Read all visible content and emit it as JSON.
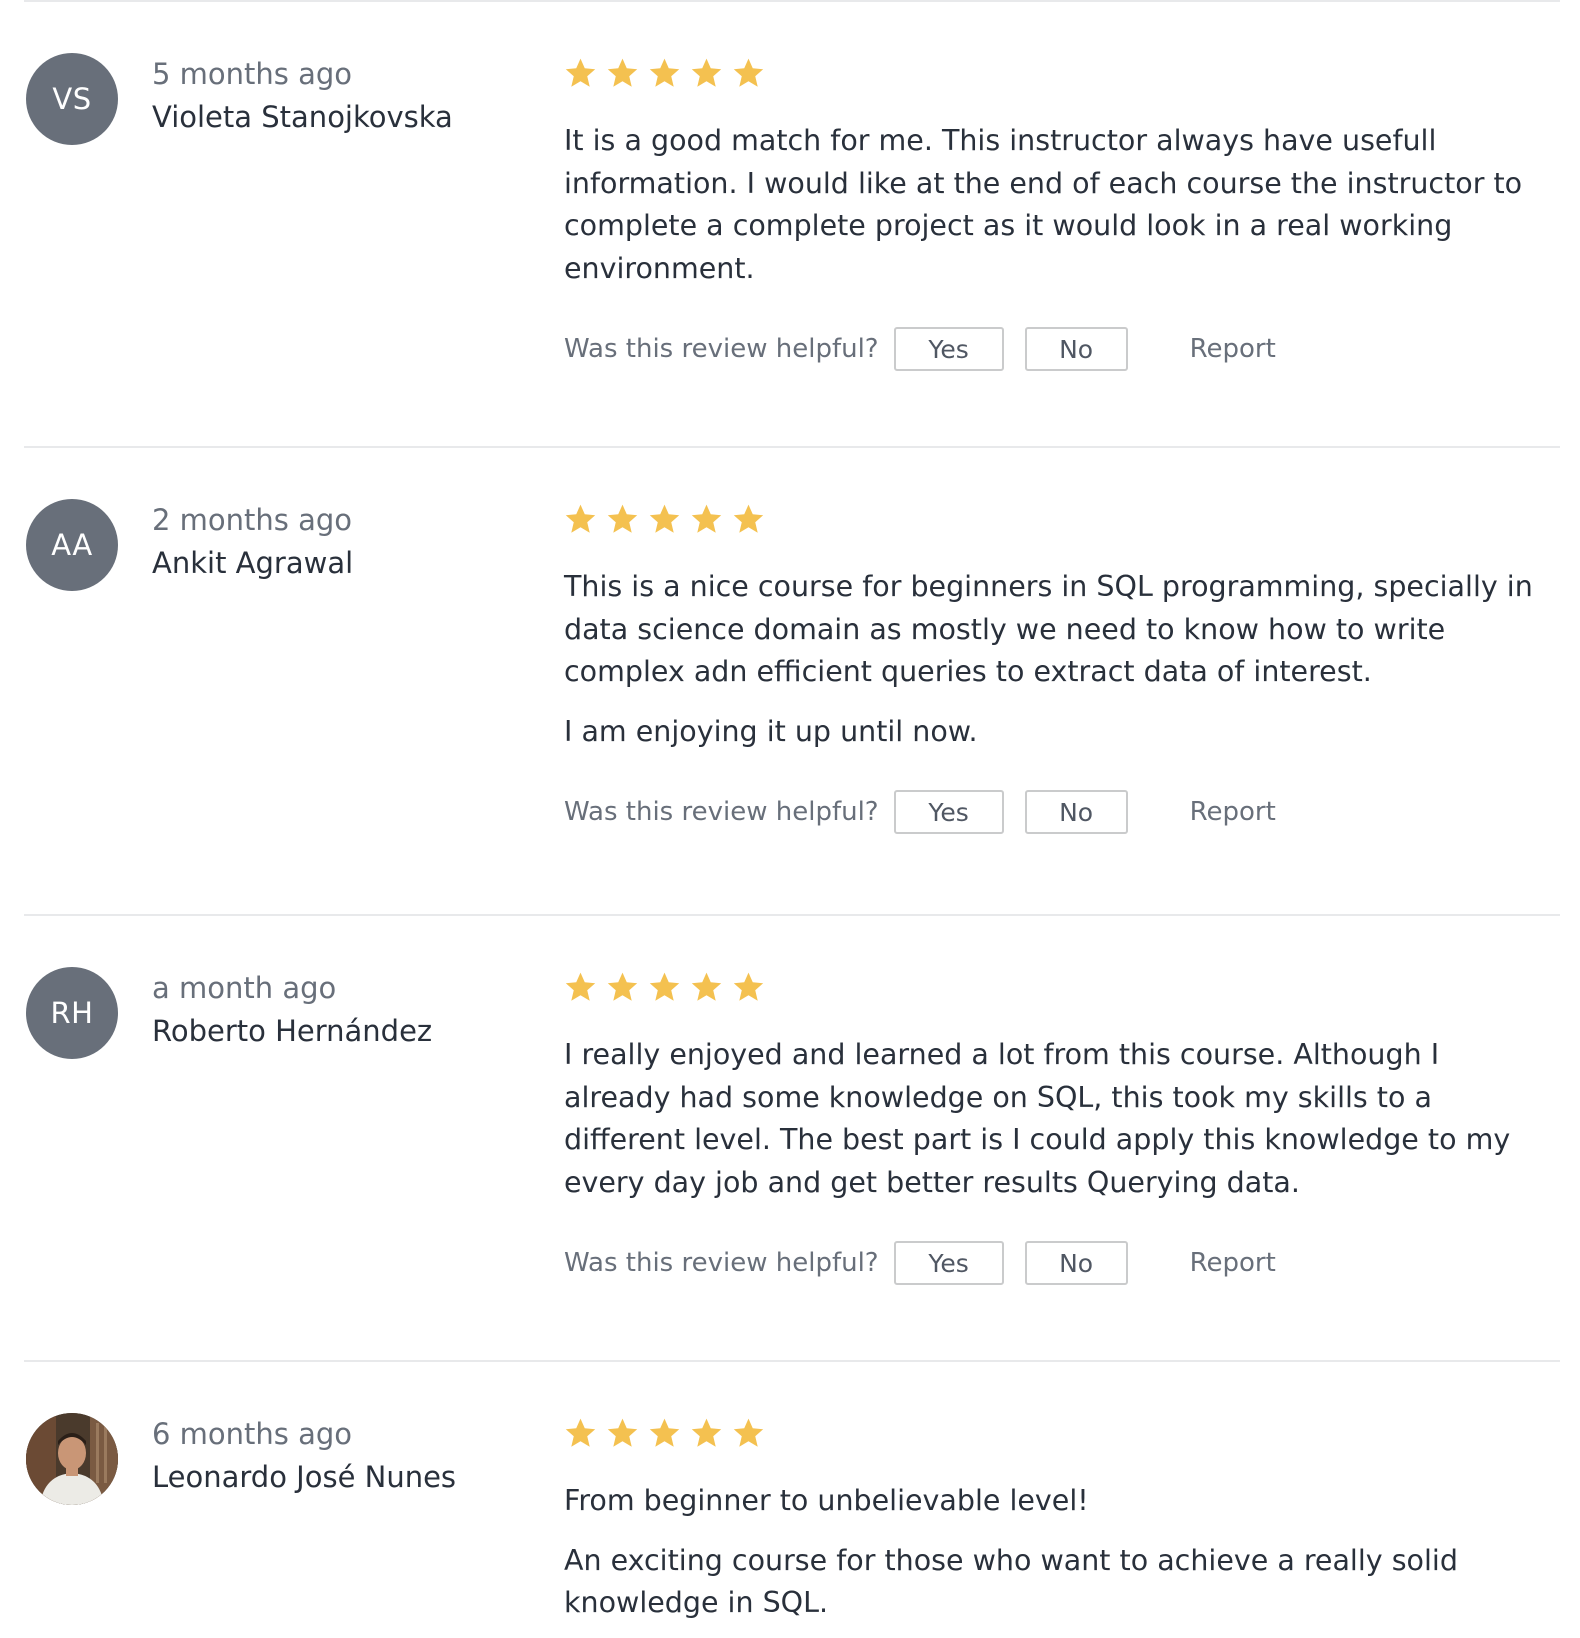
{
  "helpful_prompt": "Was this review helpful?",
  "yes_label": "Yes",
  "no_label": "No",
  "report_label": "Report",
  "star_color": "#f4c150",
  "avatar_color": "#686f7a",
  "reviews": [
    {
      "initials": "VS",
      "time": "5 months ago",
      "name": "Violeta Stanojkovska",
      "rating": 5,
      "paragraphs": [
        "It is a good match for me. This instructor always have usefull information. I would like at the end of each course the instructor to complete a complete project as it would look in a real working environment."
      ]
    },
    {
      "initials": "AA",
      "time": "2 months ago",
      "name": "Ankit Agrawal",
      "rating": 5,
      "paragraphs": [
        "This is a nice course for beginners in SQL programming, specially in data science domain as mostly we need to know how to write complex adn efficient queries to extract data of interest.",
        "I am enjoying it up until now."
      ]
    },
    {
      "initials": "RH",
      "time": "a month ago",
      "name": "Roberto Hernández",
      "rating": 5,
      "paragraphs": [
        "I really enjoyed and learned a lot from this course. Although I already had some knowledge on SQL, this took my skills to a different level. The best part is I could apply this knowledge to my every day job and get better results Querying data."
      ]
    },
    {
      "initials": "",
      "avatar_type": "photo",
      "time": "6 months ago",
      "name": "Leonardo José Nunes",
      "rating": 5,
      "paragraphs": [
        "From beginner to unbelievable level!",
        "An exciting course for those who want to achieve a really solid knowledge in SQL."
      ]
    }
  ]
}
